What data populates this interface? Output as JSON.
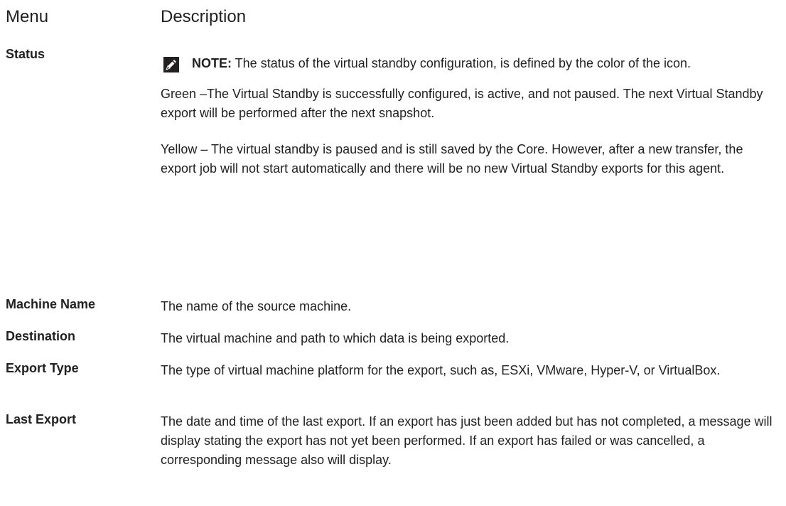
{
  "header": {
    "menu_label": "Menu",
    "description_label": "Description"
  },
  "rows": [
    {
      "term": "Status",
      "note": {
        "icon": "pencil-note-icon",
        "label": "NOTE:",
        "text": " The status of the virtual standby configuration, is defined by the color of the icon."
      },
      "paragraphs": [
        "Green –The Virtual Standby is successfully configured, is active, and not paused. The next Virtual Standby export will be performed after the next snapshot.",
        "Yellow – The virtual standby is paused and is still saved by the Core. However, after a new transfer, the export job will not start automatically and there will be no new Virtual Standby exports for this agent."
      ]
    },
    {
      "term": "Machine Name",
      "description": "The name of the source machine."
    },
    {
      "term": "Destination",
      "description": "The virtual machine and path to which data is being exported."
    },
    {
      "term": "Export Type",
      "description": "The type of virtual machine platform for the export, such as, ESXi, VMware, Hyper-V, or VirtualBox."
    },
    {
      "term": "Last Export",
      "description": "The date and time of the last export. If an export has just been added but has not completed, a message will display stating the export has not yet been performed. If an export has failed or was cancelled, a corresponding message also will display."
    }
  ]
}
